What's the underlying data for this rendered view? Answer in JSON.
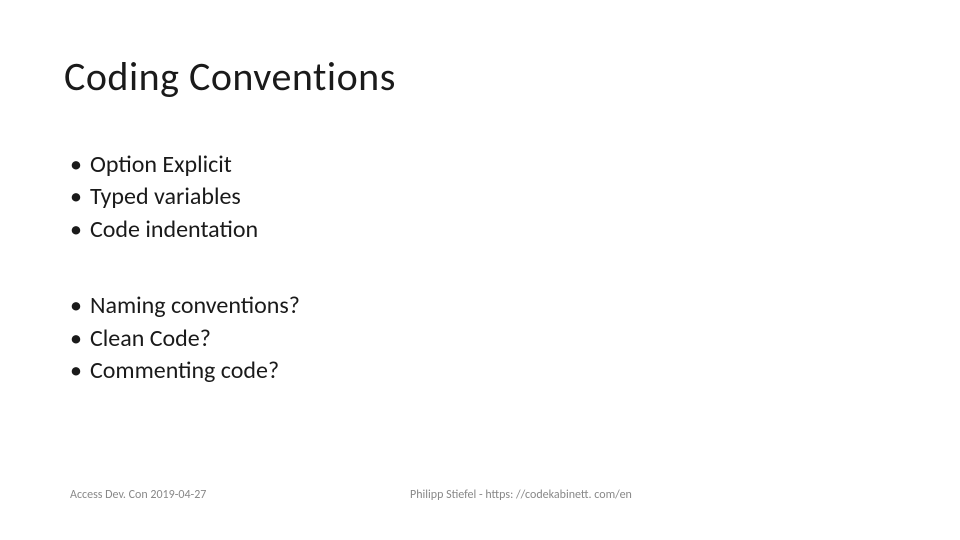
{
  "slide": {
    "title": "Coding Conventions",
    "group1": {
      "items": [
        "Option Explicit",
        "Typed variables",
        "Code indentation"
      ]
    },
    "group2": {
      "items": [
        "Naming conventions?",
        "Clean Code?",
        "Commenting code?"
      ]
    },
    "footer": {
      "left": "Access Dev. Con 2019-04-27",
      "right": "Philipp Stiefel - https: //codekabinett. com/en"
    }
  }
}
